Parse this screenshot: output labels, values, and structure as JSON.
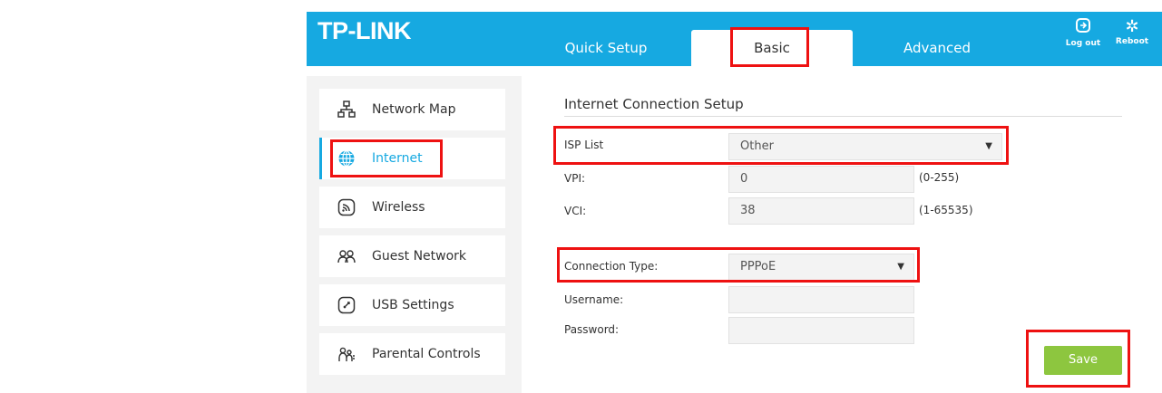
{
  "header": {
    "logo": "TP-LINK",
    "tabs": [
      {
        "label": "Quick Setup"
      },
      {
        "label": "Basic"
      },
      {
        "label": "Advanced"
      }
    ],
    "logout_label": "Log out",
    "reboot_label": "Reboot"
  },
  "sidebar": {
    "items": [
      {
        "label": "Network Map",
        "icon": "network-map-icon"
      },
      {
        "label": "Internet",
        "icon": "globe-icon",
        "active": true
      },
      {
        "label": "Wireless",
        "icon": "wireless-icon"
      },
      {
        "label": "Guest Network",
        "icon": "guest-network-icon"
      },
      {
        "label": "USB Settings",
        "icon": "usb-icon"
      },
      {
        "label": "Parental Controls",
        "icon": "parental-controls-icon"
      }
    ]
  },
  "main": {
    "title": "Internet Connection Setup",
    "isp_label": "ISP List",
    "isp_value": "Other",
    "vpi_label": "VPI:",
    "vpi_value": "0",
    "vpi_hint": "(0-255)",
    "vci_label": "VCI:",
    "vci_value": "38",
    "vci_hint": "(1-65535)",
    "conn_label": "Connection Type:",
    "conn_value": "PPPoE",
    "username_label": "Username:",
    "username_value": "",
    "password_label": "Password:",
    "password_value": "",
    "save_label": "Save"
  },
  "colors": {
    "brand": "#16a9e1",
    "highlight": "#e11111",
    "save": "#8dc63f"
  }
}
